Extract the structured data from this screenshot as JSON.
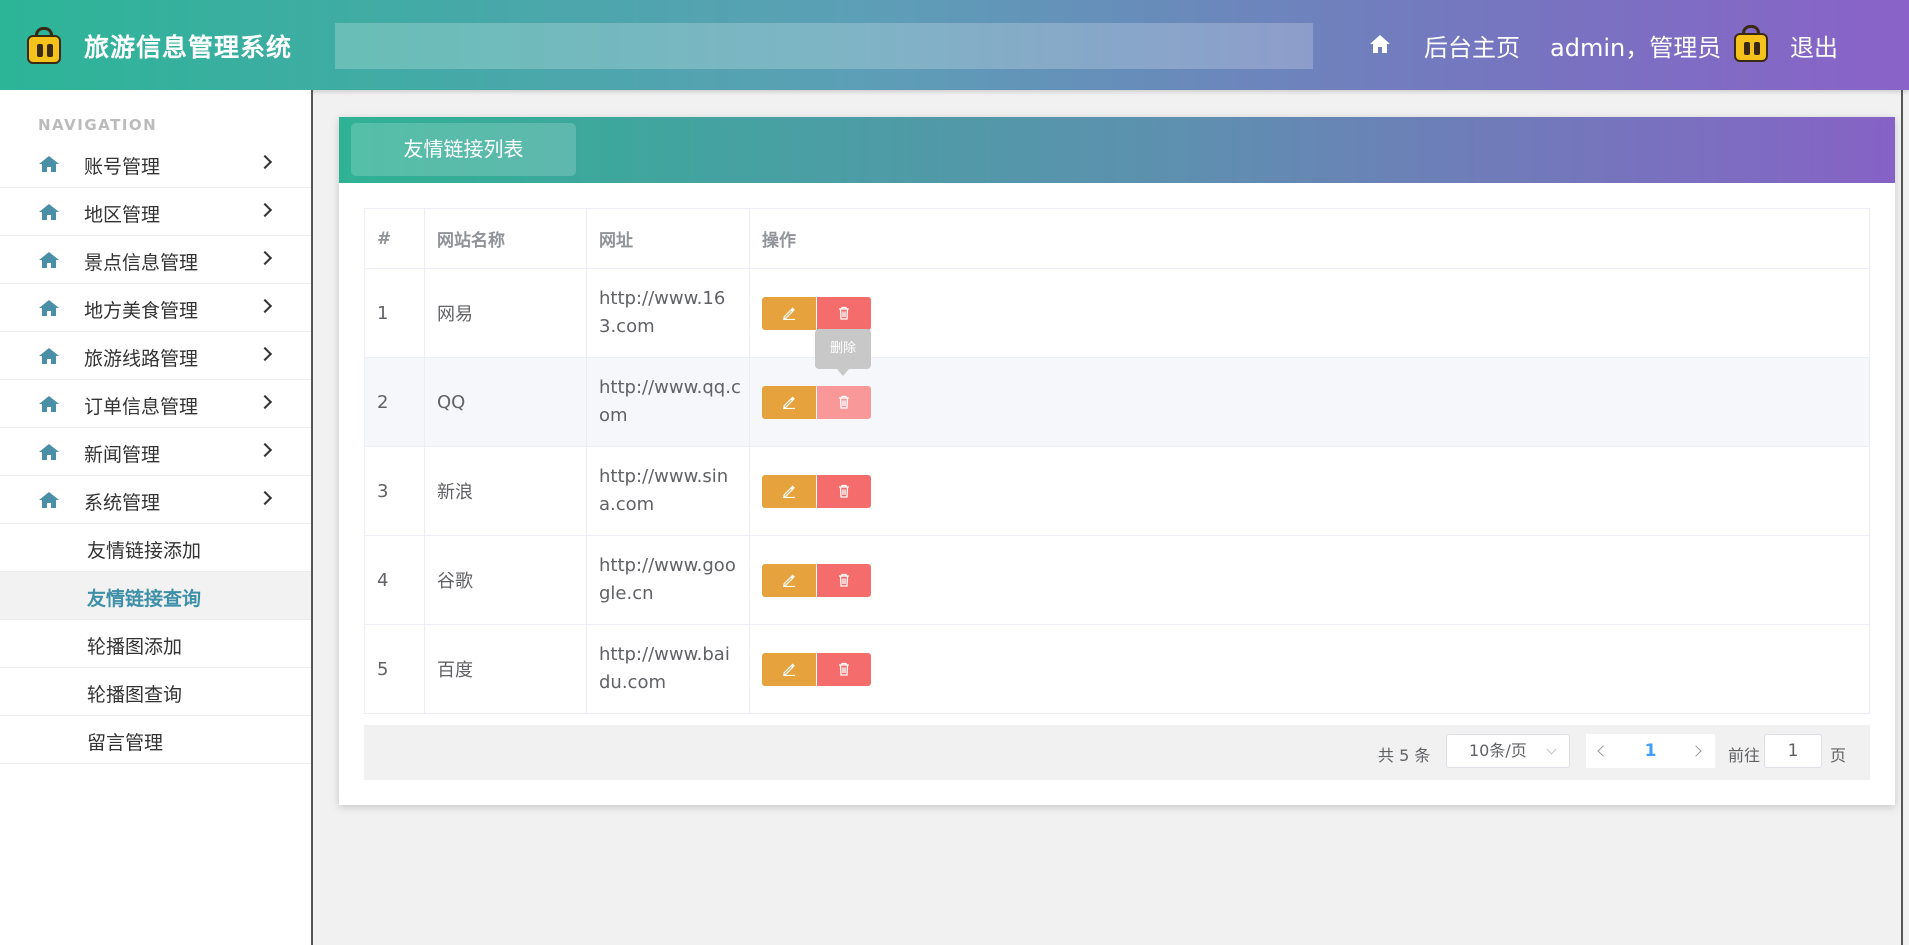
{
  "app": {
    "title": "旅游信息管理系统",
    "logo_icon": "suitcase-icon"
  },
  "header": {
    "home_link": "后台主页",
    "user": "admin，管理员",
    "logout": "退出"
  },
  "sidebar": {
    "caption": "NAVIGATION",
    "items": [
      {
        "label": "账号管理"
      },
      {
        "label": "地区管理"
      },
      {
        "label": "景点信息管理"
      },
      {
        "label": "地方美食管理"
      },
      {
        "label": "旅游线路管理"
      },
      {
        "label": "订单信息管理"
      },
      {
        "label": "新闻管理"
      },
      {
        "label": "系统管理"
      }
    ],
    "sub_items": [
      {
        "label": "友情链接添加"
      },
      {
        "label": "友情链接查询",
        "active": true
      },
      {
        "label": "轮播图添加"
      },
      {
        "label": "轮播图查询"
      },
      {
        "label": "留言管理"
      }
    ]
  },
  "panel": {
    "tab_label": "友情链接列表"
  },
  "table": {
    "headers": [
      "#",
      "网站名称",
      "网址",
      "操作"
    ],
    "rows": [
      {
        "id": "1",
        "name": "网易",
        "url": "http://www.163.com"
      },
      {
        "id": "2",
        "name": "QQ",
        "url": "http://www.qq.com"
      },
      {
        "id": "3",
        "name": "新浪",
        "url": "http://www.sina.com"
      },
      {
        "id": "4",
        "name": "谷歌",
        "url": "http://www.google.cn"
      },
      {
        "id": "5",
        "name": "百度",
        "url": "http://www.baidu.com"
      }
    ],
    "tooltip": "删除"
  },
  "pagination": {
    "total": "共 5 条",
    "page_size": "10条/页",
    "current_page": "1",
    "goto_label": "前往",
    "goto_value": "1",
    "unit_label": "页"
  },
  "colors": {
    "edit_button": "#e6a23c",
    "delete_button": "#f56c6c",
    "accent_active": "#3e8fa8"
  }
}
